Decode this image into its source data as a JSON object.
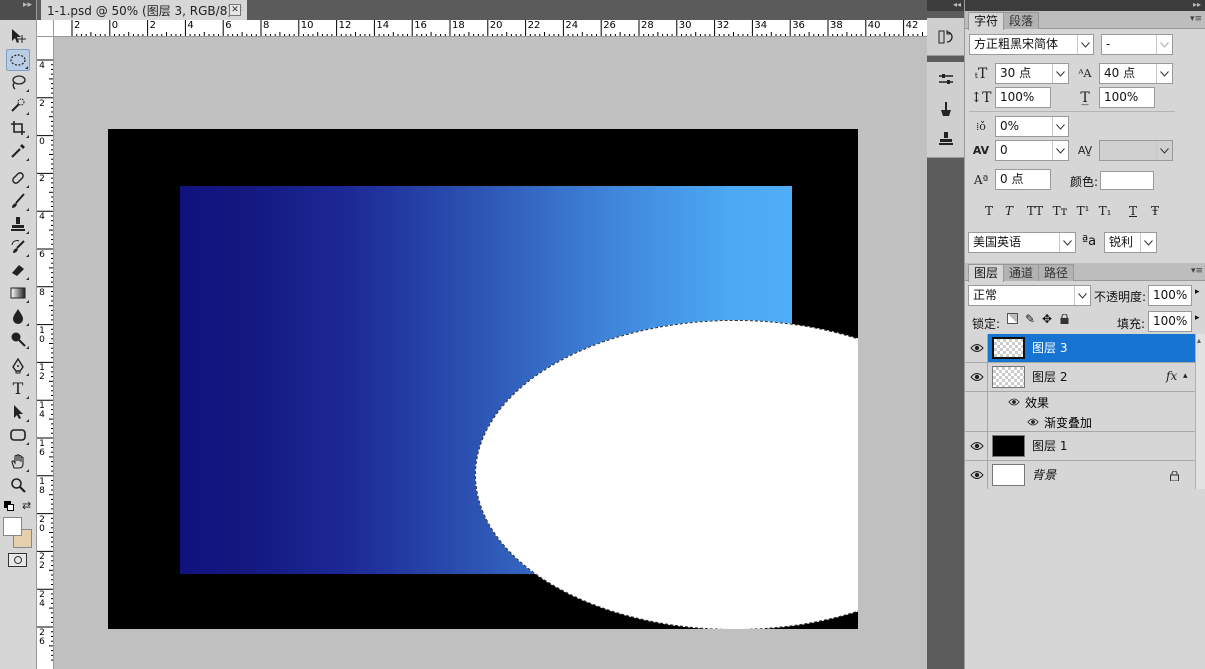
{
  "document": {
    "tab_title": "1-1.psd @ 50% (图层 3, RGB/8) *",
    "close_glyph": "✕",
    "ruler_h_labels": [
      "2",
      "0",
      "2",
      "4",
      "6",
      "8",
      "10",
      "12",
      "14",
      "16",
      "18",
      "20",
      "22",
      "24",
      "26",
      "28",
      "30",
      "32",
      "34",
      "36",
      "38",
      "40",
      "42"
    ],
    "ruler_v_labels": [
      "4",
      "2",
      "0",
      "2",
      "4",
      "6",
      "8",
      "1\n0",
      "1\n2",
      "1\n4",
      "1\n6",
      "1\n8",
      "2\n0",
      "2\n2",
      "2\n4",
      "2\n6"
    ],
    "colors": {
      "canvas_bg": "#c0c0c0",
      "black_layer": "#000000",
      "gradient_left": "#0f127e",
      "gradient_right": "#4faef7",
      "ellipse": "#ffffff"
    }
  },
  "toolbar": {
    "tools": [
      "move-tool",
      "elliptical-marquee-tool",
      "lasso-tool",
      "quick-selection-tool",
      "crop-tool",
      "eyedropper-tool",
      "spot-healing-tool",
      "brush-tool",
      "clone-stamp-tool",
      "history-brush-tool",
      "eraser-tool",
      "gradient-tool",
      "blur-tool",
      "dodge-tool",
      "pen-tool",
      "type-tool",
      "path-selection-tool",
      "rectangle-tool",
      "hand-tool",
      "zoom-tool"
    ],
    "foreground_color": "#ffffff",
    "background_color": "#e5d0ae"
  },
  "character_panel": {
    "tabs": [
      "字符",
      "段落"
    ],
    "font_family": "方正粗黑宋简体",
    "font_style": "-",
    "font_size": "30 点",
    "leading": "40 点",
    "vertical_scale": "100%",
    "horizontal_scale": "100%",
    "tsume": "0%",
    "kerning": "0",
    "tracking": "",
    "baseline_shift": "0 点",
    "color_label": "颜色:",
    "style_buttons": [
      "T",
      "T",
      "TT",
      "Tт",
      "T¹",
      "T₁",
      "T",
      "Ŧ"
    ],
    "language": "美国英语",
    "aa_label": "ªa",
    "anti_alias": "锐利"
  },
  "layers_panel": {
    "tabs": [
      "图层",
      "通道",
      "路径"
    ],
    "blend_mode": "正常",
    "opacity_label": "不透明度:",
    "opacity": "100%",
    "lock_label": "锁定:",
    "fill_label": "填充:",
    "fill": "100%",
    "fx_label": "fx",
    "layers": [
      {
        "name": "图层 3",
        "selected": true
      },
      {
        "name": "图层 2",
        "selected": false,
        "effects_label": "效果",
        "effect": "渐变叠加"
      },
      {
        "name": "图层 1",
        "selected": false
      },
      {
        "name": "背景",
        "selected": false,
        "locked": true
      }
    ]
  }
}
